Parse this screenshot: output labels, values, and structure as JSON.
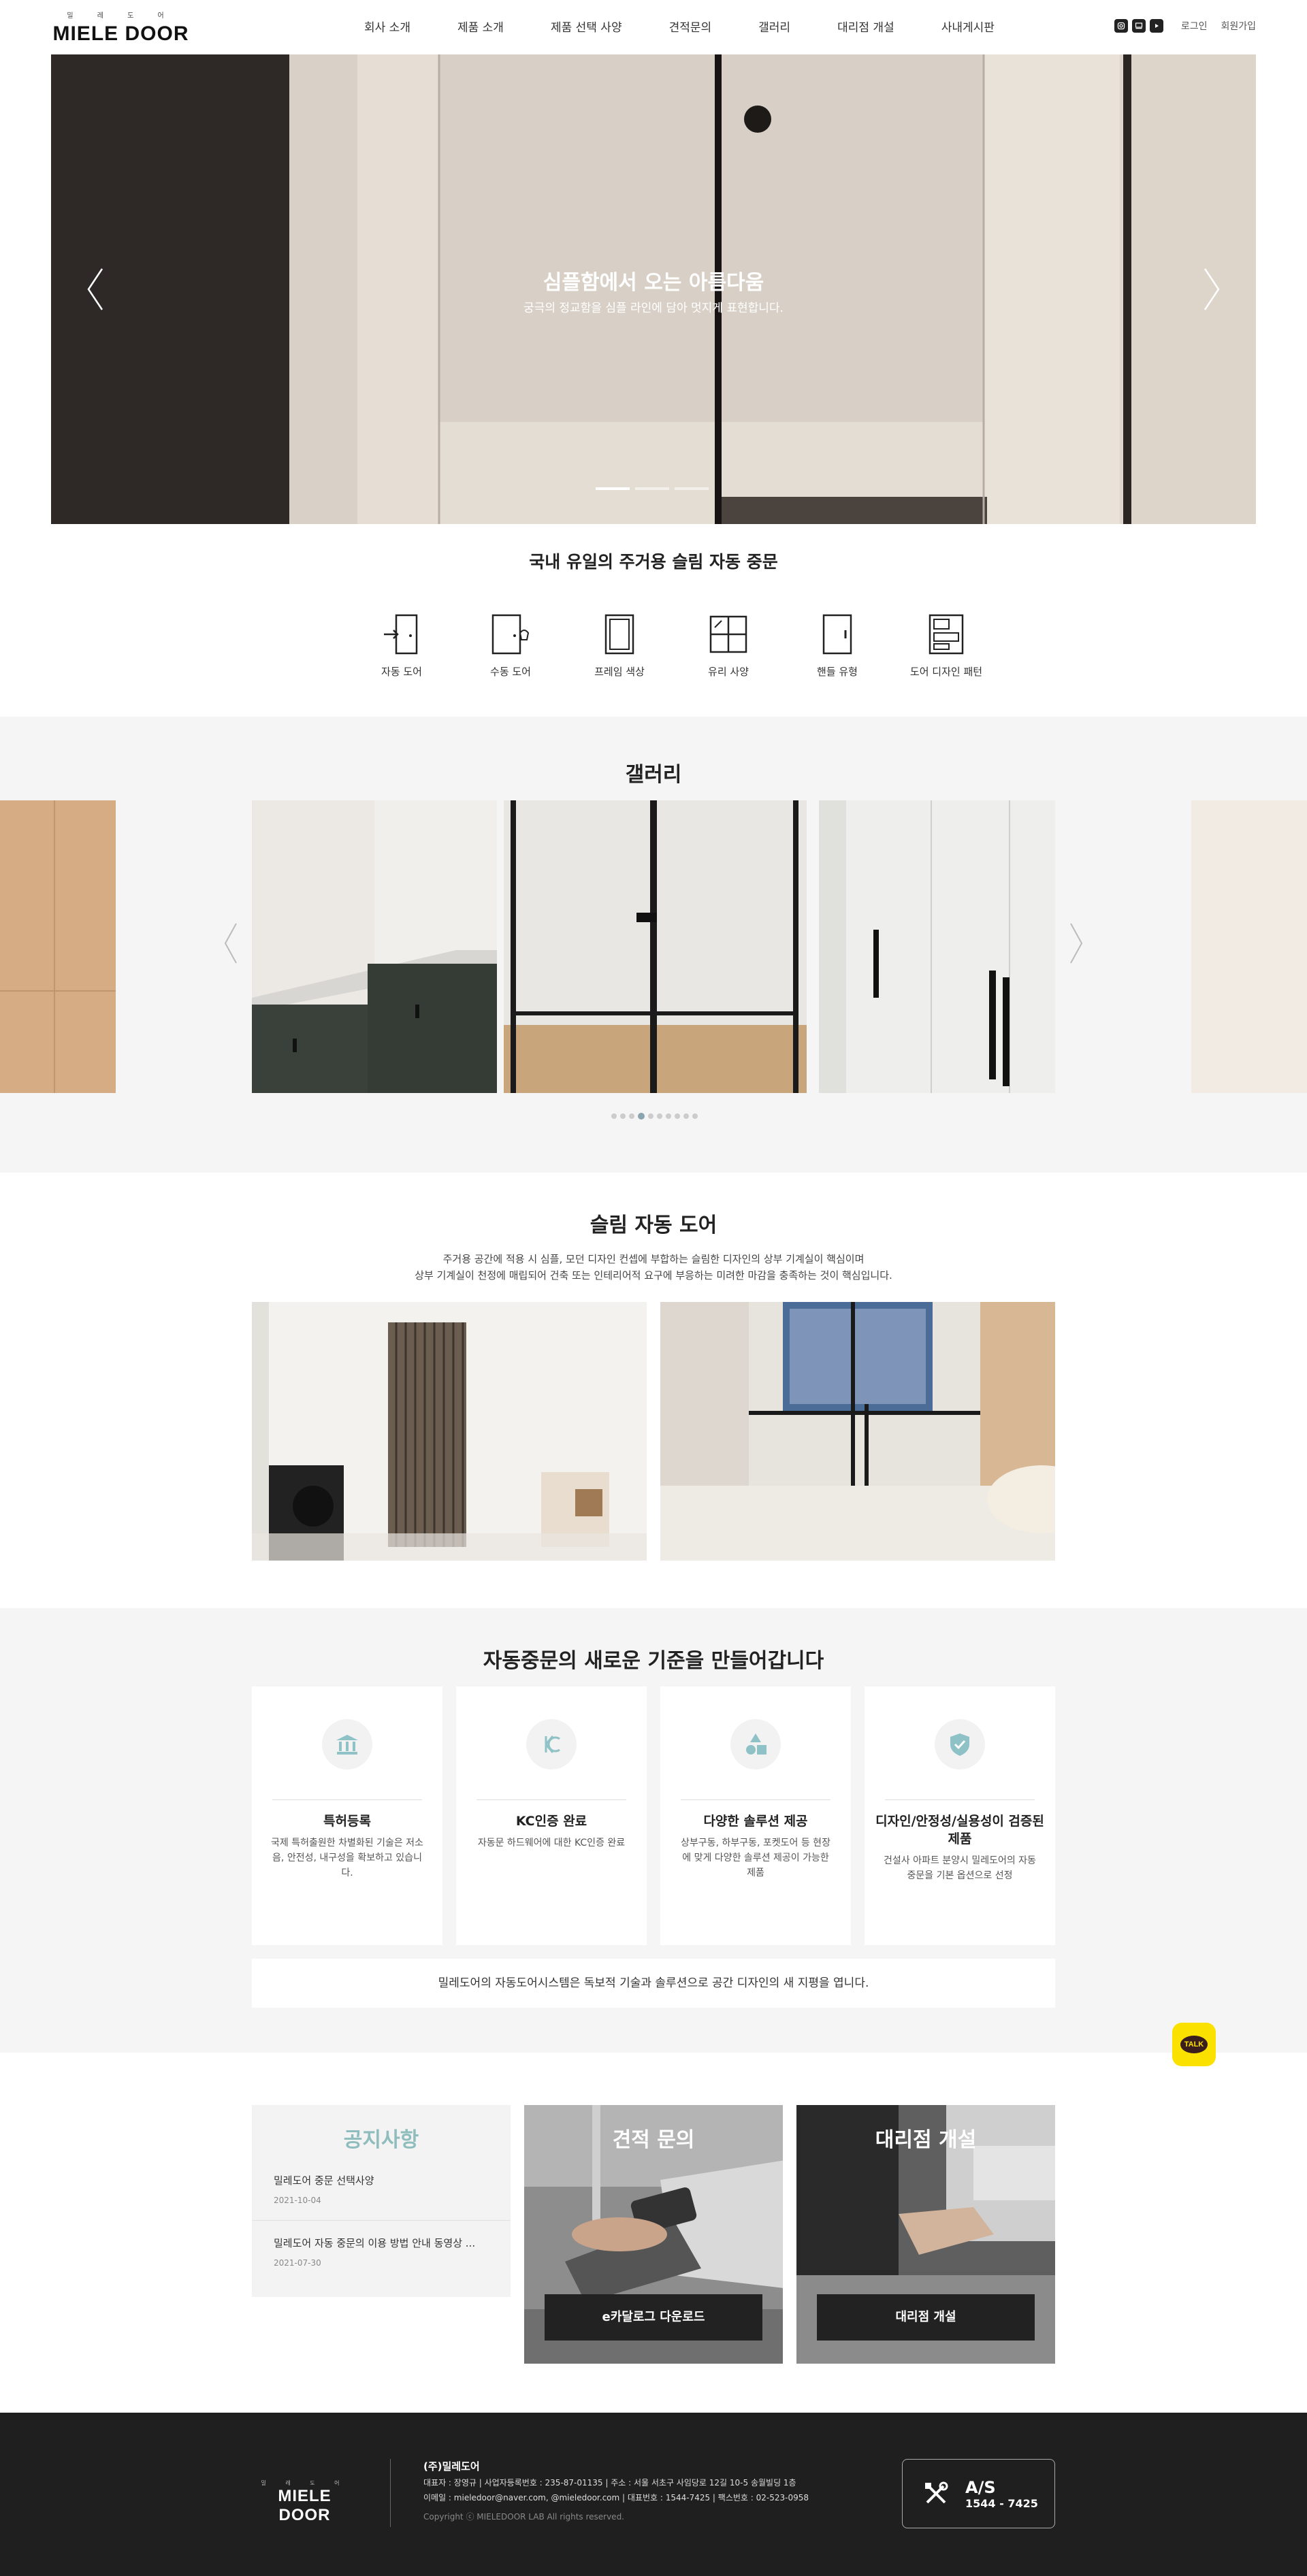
{
  "header": {
    "logo_sub": "밀 레 도 어",
    "logo_main": "MIELE DOOR",
    "nav": [
      "회사 소개",
      "제품 소개",
      "제품 선택 사양",
      "견적문의",
      "갤러리",
      "대리점 개설",
      "사내게시판"
    ],
    "login": "로그인",
    "signup": "회원가입"
  },
  "hero": {
    "title": "심플함에서 오는 아름다움",
    "subtitle": "궁극의 정교함을 심플 라인에 담아 멋지게 표현합니다.",
    "slides": 3,
    "active_slide": 1
  },
  "categories": {
    "title": "국내 유일의 주거용 슬림 자동 중문",
    "items": [
      {
        "label": "자동 도어",
        "icon": "auto-door-icon"
      },
      {
        "label": "수동 도어",
        "icon": "manual-door-icon"
      },
      {
        "label": "프레임 색상",
        "icon": "frame-color-icon"
      },
      {
        "label": "유리 사양",
        "icon": "glass-spec-icon"
      },
      {
        "label": "핸들 유형",
        "icon": "handle-type-icon"
      },
      {
        "label": "도어 디자인 패턴",
        "icon": "door-pattern-icon"
      }
    ]
  },
  "gallery": {
    "title": "갤러리",
    "dot_count": 10,
    "active_dot": 4
  },
  "slim": {
    "title": "슬림 자동 도어",
    "desc_line1": "주거용 공간에 적용 시 심플, 모던 디자인 컨셉에 부합하는 슬림한 디자인의 상부 기계실이 핵심이며",
    "desc_line2": "상부 기계실이 천정에 매립되어 건축 또는 인테리어적 요구에 부응하는 미려한 마감을 충족하는 것이 핵심입니다."
  },
  "standards": {
    "title": "자동중문의 새로운 기준을 만들어갑니다",
    "cards": [
      {
        "icon": "bank-icon",
        "title": "특허등록",
        "text": "국제 특허출원한 차별화된 기술은 저소음, 안전성, 내구성을 확보하고 있습니다."
      },
      {
        "icon": "kc-icon",
        "title": "KC인증 완료",
        "text": "자동문 하드웨어에 대한 KC인증 완료"
      },
      {
        "icon": "shapes-icon",
        "title": "다양한 솔루션 제공",
        "text": "상부구동, 하부구동, 포켓도어 등 현장에 맞게 다양한 솔루션 제공이 가능한 제품"
      },
      {
        "icon": "shield-check-icon",
        "title": "디자인/안정성/실용성이 검증된 제품",
        "text": "건설사 아파트 분양시 밀레도어의 자동 중문을 기본 옵션으로 선정"
      }
    ],
    "bar_text": "밀레도어의 자동도어시스템은 독보적 기술과 솔루션으로 공간 디자인의 새 지평을 엽니다."
  },
  "talk": {
    "label": "TALK"
  },
  "notice": {
    "title": "공지사항",
    "items": [
      {
        "title": "밀레도어 중문 선택사양",
        "date": "2021-10-04"
      },
      {
        "title": "밀레도어 자동 중문의 이용 방법 안내 동영상 ...",
        "date": "2021-07-30"
      }
    ]
  },
  "estimate": {
    "title": "견적 문의",
    "button": "e카달로그 다운로드"
  },
  "agency": {
    "title": "대리점 개설",
    "button": "대리점 개설"
  },
  "footer": {
    "logo_sub": "밀 레 도 어",
    "logo_main": "MIELE DOOR",
    "company": "(주)밀레도어",
    "line1": "대표자 : 장영규  |  사업자등록번호 : 235-87-01135  |  주소 : 서울 서초구 사임당로 12길 10-5 송월빌딩 1층",
    "line2": "이메일 : mieledoor@naver.com, @mieledoor.com  |  대표번호 : 1544-7425  |  팩스번호 : 02-523-0958",
    "copyright": "Copyright ⓒ MIELEDOOR LAB All rights reserved.",
    "as_label": "A/S",
    "as_number": "1544 - 7425"
  }
}
